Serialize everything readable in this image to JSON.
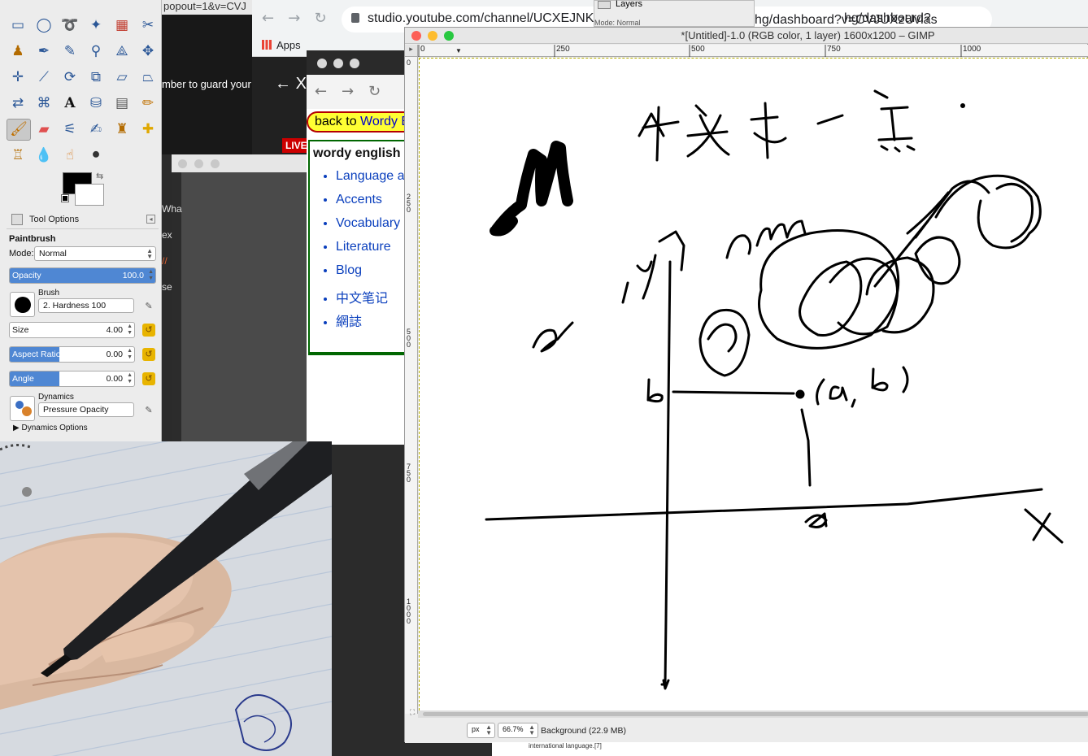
{
  "browser_back": {
    "url_prefix": "studio.youtube.com/channel/UCXEJNKH9",
    "url_suffix": "hg/dashboard?v=CVJUXzUvlas",
    "top_fragment": "popout=1&v=CVJ",
    "bookmarks_apps": "Apps"
  },
  "youtube": {
    "guard_text": "mber to guard your",
    "back_arrow": "←",
    "close_fragment": "X",
    "live_badge": "LIVE"
  },
  "side_fragments": [
    "Wha",
    "ex",
    "//",
    "se"
  ],
  "wordy_browser": {
    "back_prefix": "back to ",
    "back_link": "Wordy E",
    "box_title": "wordy english",
    "links": [
      "Language a",
      "Accents",
      "Vocabulary",
      "Literature",
      "Blog",
      "中文笔记",
      "網誌"
    ]
  },
  "gimp_toolbox": {
    "tool_options_title": "Tool Options",
    "tool_name": "Paintbrush",
    "mode_label": "Mode:",
    "mode_value": "Normal",
    "opacity_label": "Opacity",
    "opacity_value": "100.0",
    "opacity_level": 1.0,
    "brush_label": "Brush",
    "brush_value": "2. Hardness 100",
    "size_label": "Size",
    "size_value": "4.00",
    "aspect_label": "Aspect Ratio",
    "aspect_value": "0.00",
    "aspect_level": 0.4,
    "angle_label": "Angle",
    "angle_value": "0.00",
    "angle_level": 0.4,
    "dynamics_label": "Dynamics",
    "dynamics_value": "Pressure Opacity",
    "dynamics_options": "Dynamics Options",
    "fg_color": "#000000",
    "bg_color": "#ffffff"
  },
  "gimp_image_window": {
    "title": "*[Untitled]-1.0 (RGB color, 1 layer) 1600x1200 – GIMP",
    "ruler_h": [
      "0",
      "250",
      "500",
      "750",
      "1000"
    ],
    "ruler_v": [
      "0",
      "250",
      "500",
      "750",
      "1000"
    ],
    "unit": "px",
    "zoom": "66.7%",
    "status": "Background (22.9 MB)",
    "below_status": "international language.[7]"
  },
  "layers_dock": {
    "title": "Layers",
    "mode_fragment": "Mode: Normal"
  },
  "canvas_drawing": {
    "chinese_text": "中文有一点 .",
    "labels": [
      "a",
      "x",
      "y",
      "am",
      "b",
      "(a, b)",
      "a",
      "X"
    ]
  }
}
